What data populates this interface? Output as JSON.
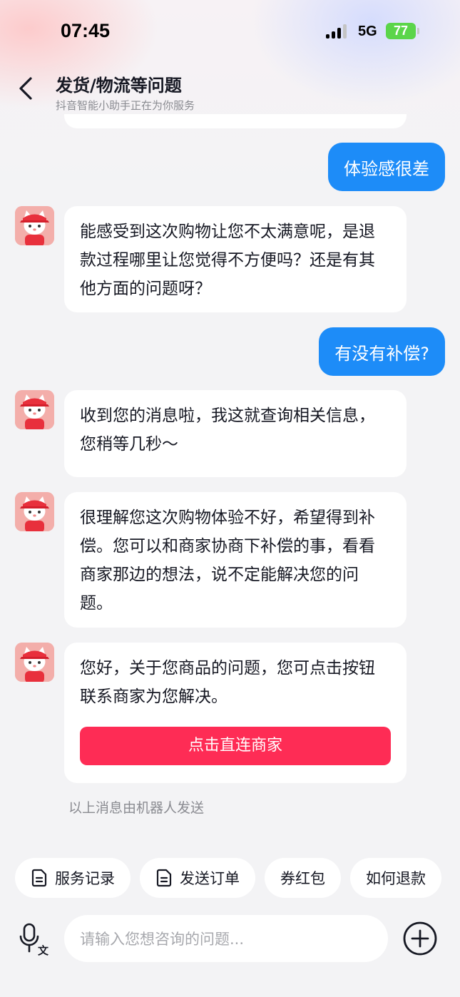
{
  "status_bar": {
    "time": "07:45",
    "network": "5G",
    "battery": "77"
  },
  "header": {
    "title": "发货/物流等问题",
    "subtitle": "抖音智能小助手正在为你服务"
  },
  "messages": [
    {
      "from": "user",
      "text": "体验感很差"
    },
    {
      "from": "bot",
      "text": "能感受到这次购物让您不太满意呢，是退款过程哪里让您觉得不方便吗？还是有其他方面的问题呀？"
    },
    {
      "from": "user",
      "text": "有没有补偿?"
    },
    {
      "from": "bot",
      "text": "收到您的消息啦，我这就查询相关信息，您稍等几秒～"
    },
    {
      "from": "bot",
      "text": "很理解您这次购物体验不好，希望得到补偿。您可以和商家协商下补偿的事，看看商家那边的想法，说不定能解决您的问题。"
    },
    {
      "from": "bot",
      "text": "您好，关于您商品的问题，您可点击按钮联系商家为您解决。",
      "button": "点击直连商家"
    }
  ],
  "bot_note": "以上消息由机器人发送",
  "quick_actions": [
    {
      "label": "服务记录",
      "icon": "document-icon"
    },
    {
      "label": "发送订单",
      "icon": "document-icon"
    },
    {
      "label": "券红包"
    },
    {
      "label": "如何退款"
    }
  ],
  "input": {
    "placeholder": "请输入您想咨询的问题..."
  },
  "colors": {
    "user_bubble": "#1d8cf8",
    "cta": "#fe2c55",
    "background": "#f3f3f5"
  }
}
